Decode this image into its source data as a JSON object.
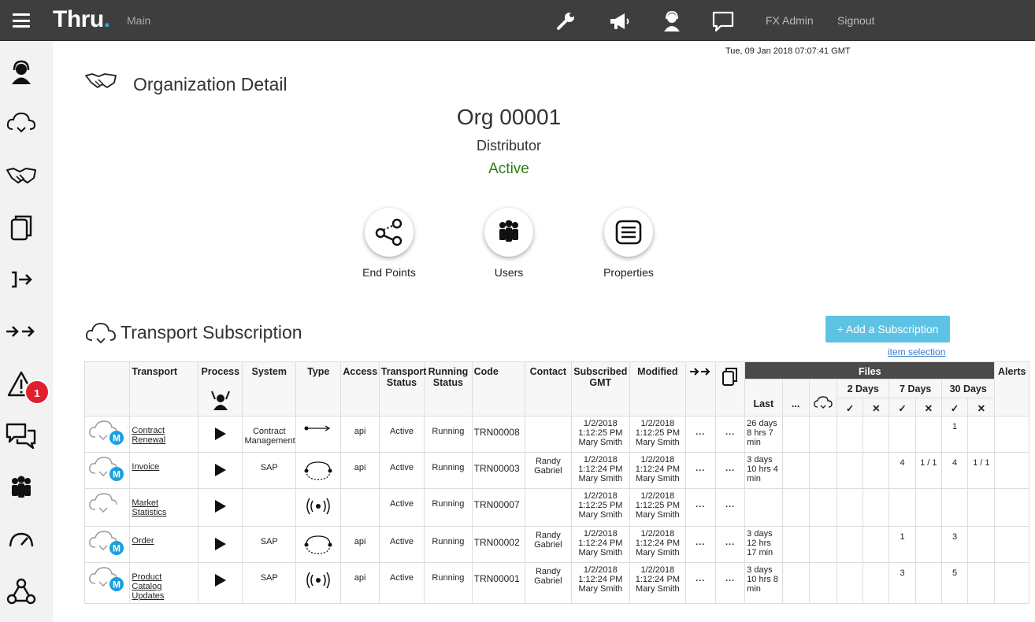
{
  "header": {
    "logo_text": "Thru",
    "logo_dot": ".",
    "breadcrumb": "Main",
    "admin_label": "FX Admin",
    "signout_label": "Signout"
  },
  "sidebar": {
    "alerts_badge": "1"
  },
  "timestamp": "Tue, 09 Jan 2018 07:07:41 GMT",
  "page_title": "Organization Detail",
  "org": {
    "name": "Org 00001",
    "type": "Distributor",
    "status": "Active"
  },
  "actions": [
    "End Points",
    "Users",
    "Properties"
  ],
  "section_title": "Transport Subscription",
  "add_subscription_label": "+ Add a Subscription",
  "item_selection_label": "item selection",
  "table": {
    "headers": {
      "transport": "Transport",
      "process": "Process",
      "system": "System",
      "type": "Type",
      "access": "Access",
      "transport_status_1": "Transport",
      "transport_status_2": "Status",
      "running_status_1": "Running",
      "running_status_2": "Status",
      "code": "Code",
      "contact": "Contact",
      "subscribed_1": "Subscribed",
      "subscribed_2": "GMT",
      "modified": "Modified",
      "files": "Files",
      "alerts": "Alerts",
      "last": "Last",
      "days2": "2 Days",
      "days7": "7 Days",
      "days30": "30 Days",
      "more": "..."
    },
    "rows": [
      {
        "transport_1": "Contract",
        "transport_2": "Renewal",
        "system_1": "Contract",
        "system_2": "Management",
        "access": "api",
        "tstatus": "Active",
        "rstatus": "Running",
        "code": "TRN00008",
        "contact_1": "",
        "contact_2": "",
        "sub_1": "1/2/2018",
        "sub_2": "1:12:25 PM",
        "sub_3": "Mary Smith",
        "mod_1": "1/2/2018",
        "mod_2": "1:12:25 PM",
        "mod_3": "Mary Smith",
        "last_1": "26 days",
        "last_2": "8 hrs 7",
        "last_3": "min",
        "d7ok": "",
        "d7x": "",
        "d30ok": "1",
        "d30x": ""
      },
      {
        "transport_1": "Invoice",
        "transport_2": "",
        "system_1": "SAP",
        "system_2": "",
        "access": "api",
        "tstatus": "Active",
        "rstatus": "Running",
        "code": "TRN00003",
        "contact_1": "Randy",
        "contact_2": "Gabriel",
        "sub_1": "1/2/2018",
        "sub_2": "1:12:24 PM",
        "sub_3": "Mary Smith",
        "mod_1": "1/2/2018",
        "mod_2": "1:12:24 PM",
        "mod_3": "Mary Smith",
        "last_1": "3 days",
        "last_2": "10 hrs 4",
        "last_3": "min",
        "d7ok": "4",
        "d7x": "1 / 1",
        "d30ok": "4",
        "d30x": "1 / 1"
      },
      {
        "transport_1": "Market",
        "transport_2": "Statistics",
        "system_1": "",
        "system_2": "",
        "access": "",
        "tstatus": "Active",
        "rstatus": "Running",
        "code": "TRN00007",
        "contact_1": "",
        "contact_2": "",
        "sub_1": "1/2/2018",
        "sub_2": "1:12:25 PM",
        "sub_3": "Mary Smith",
        "mod_1": "1/2/2018",
        "mod_2": "1:12:25 PM",
        "mod_3": "Mary Smith",
        "last_1": "",
        "last_2": "",
        "last_3": "",
        "d7ok": "",
        "d7x": "",
        "d30ok": "",
        "d30x": ""
      },
      {
        "transport_1": "Order",
        "transport_2": "",
        "system_1": "SAP",
        "system_2": "",
        "access": "api",
        "tstatus": "Active",
        "rstatus": "Running",
        "code": "TRN00002",
        "contact_1": "Randy",
        "contact_2": "Gabriel",
        "sub_1": "1/2/2018",
        "sub_2": "1:12:24 PM",
        "sub_3": "Mary Smith",
        "mod_1": "1/2/2018",
        "mod_2": "1:12:24 PM",
        "mod_3": "Mary Smith",
        "last_1": "3 days",
        "last_2": "12 hrs",
        "last_3": "17 min",
        "d7ok": "1",
        "d7x": "",
        "d30ok": "3",
        "d30x": ""
      },
      {
        "transport_1": "Product",
        "transport_2": "Catalog",
        "transport_3": "Updates",
        "system_1": "SAP",
        "system_2": "",
        "access": "api",
        "tstatus": "Active",
        "rstatus": "Running",
        "code": "TRN00001",
        "contact_1": "Randy",
        "contact_2": "Gabriel",
        "sub_1": "1/2/2018",
        "sub_2": "1:12:24 PM",
        "sub_3": "Mary Smith",
        "mod_1": "1/2/2018",
        "mod_2": "1:12:24 PM",
        "mod_3": "Mary Smith",
        "last_1": "3 days",
        "last_2": "10 hrs 8",
        "last_3": "min",
        "d7ok": "3",
        "d7x": "",
        "d30ok": "5",
        "d30x": ""
      }
    ]
  }
}
